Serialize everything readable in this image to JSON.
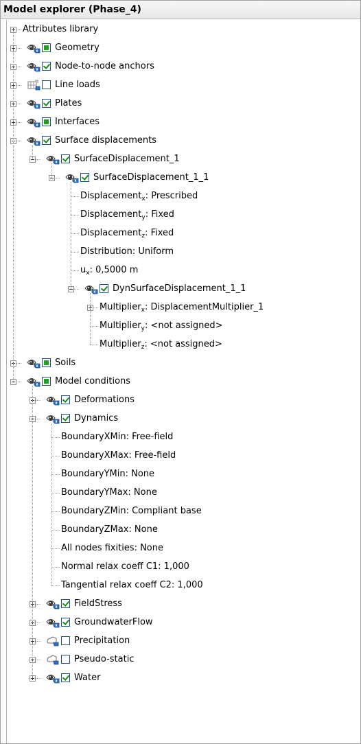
{
  "panel": {
    "title": "Model explorer (Phase_4)"
  },
  "rows": [
    {
      "level": 0,
      "exp": "plus",
      "icon": "none",
      "chk": "none",
      "label": "Attributes library"
    },
    {
      "level": 0,
      "exp": "plus",
      "icon": "eye",
      "chk": "square",
      "label": "Geometry"
    },
    {
      "level": 0,
      "exp": "plus",
      "icon": "eye",
      "chk": "checked",
      "label": "Node-to-node anchors"
    },
    {
      "level": 0,
      "exp": "plus",
      "icon": "grid",
      "chk": "empty",
      "label": "Line loads"
    },
    {
      "level": 0,
      "exp": "plus",
      "icon": "eye",
      "chk": "checked",
      "label": "Plates"
    },
    {
      "level": 0,
      "exp": "plus",
      "icon": "eye",
      "chk": "square",
      "label": "Interfaces"
    },
    {
      "level": 0,
      "exp": "minus",
      "icon": "eye",
      "chk": "checked",
      "label": "Surface displacements"
    },
    {
      "level": 1,
      "exp": "minus",
      "icon": "eye",
      "chk": "checked",
      "label": "SurfaceDisplacement_1"
    },
    {
      "level": 2,
      "exp": "minus",
      "icon": "eye",
      "chk": "checked",
      "label": "SurfaceDisplacement_1_1"
    },
    {
      "level": 3,
      "exp": "none",
      "icon": "none",
      "chk": "none",
      "label": "Displacement",
      "sub": "x",
      "after": ": Prescribed"
    },
    {
      "level": 3,
      "exp": "none",
      "icon": "none",
      "chk": "none",
      "label": "Displacement",
      "sub": "y",
      "after": ": Fixed"
    },
    {
      "level": 3,
      "exp": "none",
      "icon": "none",
      "chk": "none",
      "label": "Displacement",
      "sub": "z",
      "after": ": Fixed"
    },
    {
      "level": 3,
      "exp": "none",
      "icon": "none",
      "chk": "none",
      "label": "Distribution: Uniform"
    },
    {
      "level": 3,
      "exp": "none",
      "icon": "none",
      "chk": "none",
      "label": "u",
      "sub": "x",
      "after": ": 0,5000 m"
    },
    {
      "level": 3,
      "exp": "minus",
      "icon": "eye",
      "chk": "checked",
      "label": "DynSurfaceDisplacement_1_1"
    },
    {
      "level": 4,
      "exp": "plus",
      "icon": "none",
      "chk": "none",
      "label": "Multiplier",
      "sub": "x",
      "after": ": DisplacementMultiplier_1"
    },
    {
      "level": 4,
      "exp": "none",
      "icon": "none",
      "chk": "none",
      "label": "Multiplier",
      "sub": "y",
      "after": ": <not assigned>"
    },
    {
      "level": 4,
      "exp": "none",
      "icon": "none",
      "chk": "none",
      "label": "Multiplier",
      "sub": "z",
      "after": ": <not assigned>"
    },
    {
      "level": 0,
      "exp": "plus",
      "icon": "eye",
      "chk": "square",
      "label": "Soils"
    },
    {
      "level": 0,
      "exp": "minus",
      "icon": "eye",
      "chk": "square",
      "label": "Model conditions"
    },
    {
      "level": 1,
      "exp": "plus",
      "icon": "eye",
      "chk": "checked",
      "label": "Deformations"
    },
    {
      "level": 1,
      "exp": "minus",
      "icon": "eye",
      "chk": "checked",
      "label": "Dynamics"
    },
    {
      "level": 2,
      "exp": "none",
      "icon": "none",
      "chk": "none",
      "label": "BoundaryXMin: Free-field"
    },
    {
      "level": 2,
      "exp": "none",
      "icon": "none",
      "chk": "none",
      "label": "BoundaryXMax: Free-field"
    },
    {
      "level": 2,
      "exp": "none",
      "icon": "none",
      "chk": "none",
      "label": "BoundaryYMin: None"
    },
    {
      "level": 2,
      "exp": "none",
      "icon": "none",
      "chk": "none",
      "label": "BoundaryYMax: None"
    },
    {
      "level": 2,
      "exp": "none",
      "icon": "none",
      "chk": "none",
      "label": "BoundaryZMin: Compliant base"
    },
    {
      "level": 2,
      "exp": "none",
      "icon": "none",
      "chk": "none",
      "label": "BoundaryZMax: None"
    },
    {
      "level": 2,
      "exp": "none",
      "icon": "none",
      "chk": "none",
      "label": "All nodes fixities: None"
    },
    {
      "level": 2,
      "exp": "none",
      "icon": "none",
      "chk": "none",
      "label": "Normal relax coeff C1: 1,000"
    },
    {
      "level": 2,
      "exp": "none",
      "icon": "none",
      "chk": "none",
      "label": "Tangential relax coeff C2: 1,000"
    },
    {
      "level": 1,
      "exp": "plus",
      "icon": "eye",
      "chk": "checked",
      "label": "FieldStress"
    },
    {
      "level": 1,
      "exp": "plus",
      "icon": "eye",
      "chk": "checked",
      "label": "GroundwaterFlow"
    },
    {
      "level": 1,
      "exp": "plus",
      "icon": "cloud",
      "chk": "empty",
      "label": "Precipitation"
    },
    {
      "level": 1,
      "exp": "plus",
      "icon": "cloud",
      "chk": "empty",
      "label": "Pseudo-static"
    },
    {
      "level": 1,
      "exp": "plus",
      "icon": "eye",
      "chk": "checked",
      "label": "Water"
    }
  ],
  "colors": {
    "check": "#1a8a1a",
    "square_fill": "#1fa31f",
    "checkbox_border": "#1c5180",
    "eye_blue": "#2f6fbe"
  }
}
